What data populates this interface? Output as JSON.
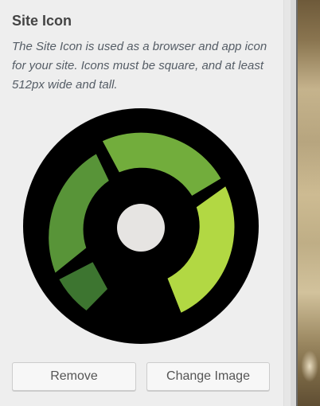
{
  "section": {
    "title": "Site Icon",
    "description": "The Site Icon is used as a browser and app icon for your site. Icons must be square, and at least 512px wide and tall."
  },
  "icon_preview": {
    "colors": {
      "background": "#000000",
      "top_segment": "#72ad3c",
      "left_segment": "#589438",
      "bottom_left_segment": "#3d7530",
      "right_segment": "#b2d843",
      "center": "#e6e4e2"
    }
  },
  "actions": {
    "remove_label": "Remove",
    "change_label": "Change Image"
  }
}
